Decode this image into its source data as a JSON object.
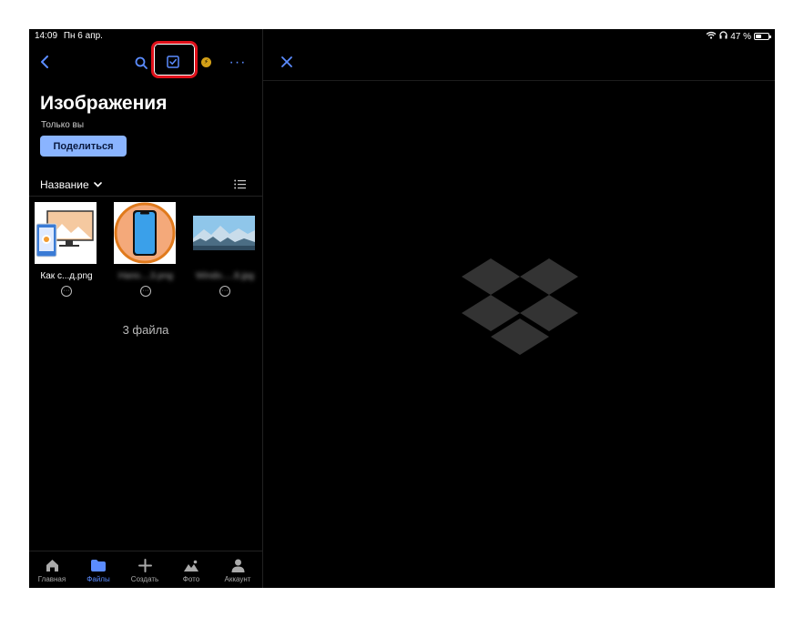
{
  "status_bar": {
    "time": "14:09",
    "date": "Пн 6 апр.",
    "battery": "47 %",
    "battery_level": 0.47
  },
  "toolbar": {
    "back_icon": "chevron-left-icon",
    "search_icon": "search-icon",
    "select_icon": "checkbox-select-icon",
    "more_label": "···"
  },
  "folder": {
    "title": "Изображения",
    "subtitle": "Только вы",
    "share_label": "Поделиться"
  },
  "sort": {
    "label": "Название"
  },
  "files": [
    {
      "name": "Как с...д.png"
    },
    {
      "name": "Напо....3.png"
    },
    {
      "name": "Windo.....8.jpg"
    }
  ],
  "file_count": "3 файла",
  "tabs": [
    {
      "label": "Главная",
      "icon": "home-icon"
    },
    {
      "label": "Файлы",
      "icon": "folder-icon"
    },
    {
      "label": "Создать",
      "icon": "plus-icon"
    },
    {
      "label": "Фото",
      "icon": "photo-icon"
    },
    {
      "label": "Аккаунт",
      "icon": "account-icon"
    }
  ],
  "colors": {
    "accent": "#5b8cff",
    "highlight": "#e0101a",
    "share_button": "#8ab4ff",
    "background": "#000000"
  }
}
